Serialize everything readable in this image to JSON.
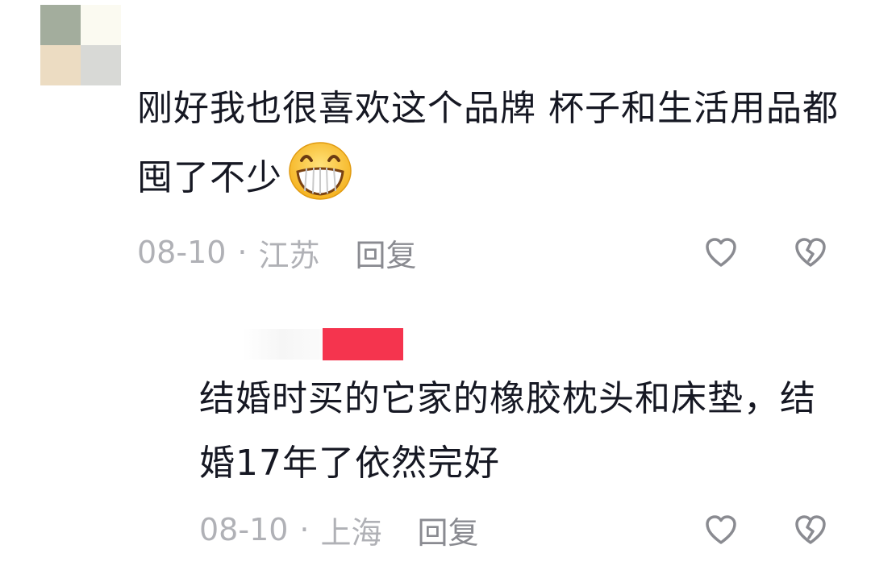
{
  "avatar": {
    "colors": [
      "#a3ad9d",
      "#fbfaf1",
      "#ecdcc2",
      "#d8d9d6"
    ]
  },
  "comments": [
    {
      "text": "刚好我也很喜欢这个品牌 杯子和生活用品都囤了不少",
      "emoji": "grinning-face-emoji",
      "date": "08-10",
      "separator": "·",
      "location": "江苏",
      "reply_label": "回复"
    },
    {
      "text": "结婚时买的它家的橡胶枕头和床垫，结婚17年了依然完好",
      "date": "08-10",
      "separator": "·",
      "location": "上海",
      "reply_label": "回复",
      "username_redaction_color": "#f5344e"
    }
  ],
  "icons": {
    "like": "heart-outline-icon",
    "dislike": "broken-heart-outline-icon"
  },
  "colors": {
    "text": "#161823",
    "meta": "#b0b1b6",
    "reply": "#8a8b91",
    "icon": "#8a8b91"
  }
}
